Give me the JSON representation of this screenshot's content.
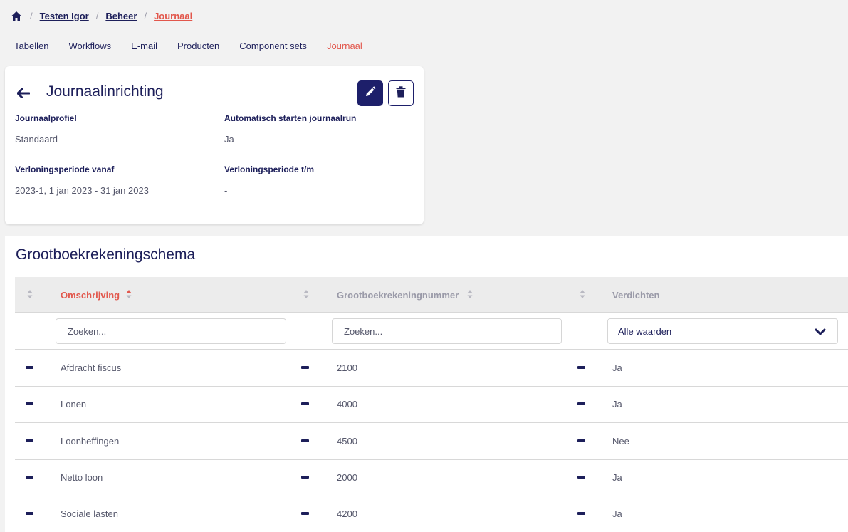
{
  "breadcrumb": {
    "home_icon": "home-icon",
    "items": [
      "Testen Igor",
      "Beheer"
    ],
    "current": "Journaal"
  },
  "tabs": [
    "Tabellen",
    "Workflows",
    "E-mail",
    "Producten",
    "Component sets",
    "Journaal"
  ],
  "active_tab": "Journaal",
  "card": {
    "title": "Journaalinrichting",
    "fields": {
      "profile_label": "Journaalprofiel",
      "profile_value": "Standaard",
      "autostart_label": "Automatisch starten journaalrun",
      "autostart_value": "Ja",
      "from_label": "Verloningsperiode vanaf",
      "from_value": "2023-1, 1 jan 2023 - 31 jan 2023",
      "to_label": "Verloningsperiode t/m",
      "to_value": "-"
    }
  },
  "ledger": {
    "title": "Grootboekrekeningschema",
    "columns": [
      "Omschrijving",
      "Grootboekrekeningnummer",
      "Verdichten"
    ],
    "sorted_column": "Omschrijving",
    "filters": {
      "description_placeholder": "Zoeken...",
      "number_placeholder": "Zoeken...",
      "condense_selected": "Alle waarden"
    },
    "rows": [
      {
        "description": "Afdracht fiscus",
        "number": "2100",
        "condense": "Ja"
      },
      {
        "description": "Lonen",
        "number": "4000",
        "condense": "Ja"
      },
      {
        "description": "Loonheffingen",
        "number": "4500",
        "condense": "Nee"
      },
      {
        "description": "Netto loon",
        "number": "2000",
        "condense": "Ja"
      },
      {
        "description": "Sociale lasten",
        "number": "4200",
        "condense": "Ja"
      }
    ]
  },
  "colors": {
    "primary": "#1d1f5a",
    "accent": "#e2574c",
    "background": "#f2f2f2"
  }
}
